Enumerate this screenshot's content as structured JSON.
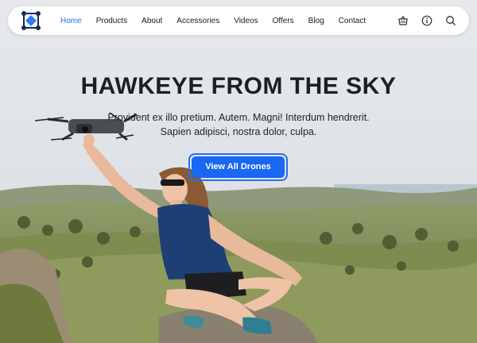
{
  "nav": {
    "logo_icon": "drone-logo-icon",
    "links": [
      {
        "label": "Home",
        "active": true
      },
      {
        "label": "Products",
        "active": false
      },
      {
        "label": "About",
        "active": false
      },
      {
        "label": "Accessories",
        "active": false
      },
      {
        "label": "Videos",
        "active": false
      },
      {
        "label": "Offers",
        "active": false
      },
      {
        "label": "Blog",
        "active": false
      },
      {
        "label": "Contact",
        "active": false
      }
    ],
    "icons": [
      "cart-icon",
      "info-icon",
      "search-icon"
    ]
  },
  "hero": {
    "headline": "HAWKEYE FROM THE SKY",
    "subtitle_line1": "Provident ex illo pretium. Autem. Magni! Interdum hendrerit.",
    "subtitle_line2": "Sapien adipisci, nostra dolor, culpa.",
    "cta_label": "View All Drones"
  },
  "colors": {
    "accent": "#1a73e8",
    "button": "#1967f2",
    "text": "#1d1f24"
  }
}
